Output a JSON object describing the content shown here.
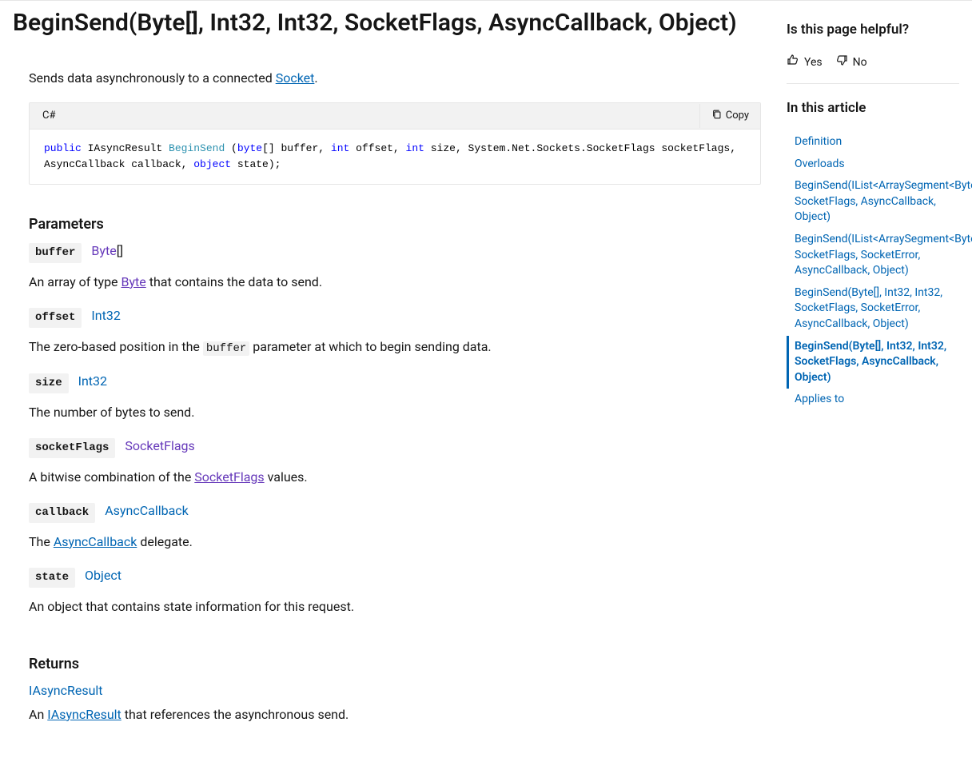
{
  "title": "BeginSend(Byte[], Int32, Int32, SocketFlags, AsyncCallback, Object)",
  "intro_prefix": "Sends data asynchronously to a connected ",
  "intro_link": "Socket",
  "intro_suffix": ".",
  "code": {
    "lang": "C#",
    "copy_label": "Copy",
    "tokens": [
      {
        "t": "public ",
        "c": "k-blue"
      },
      {
        "t": "IAsyncResult ",
        "c": "k-dark"
      },
      {
        "t": "BeginSend ",
        "c": "k-teal"
      },
      {
        "t": "(",
        "c": "k-dark"
      },
      {
        "t": "byte",
        "c": "k-blue"
      },
      {
        "t": "[] buffer, ",
        "c": "k-dark"
      },
      {
        "t": "int",
        "c": "k-blue"
      },
      {
        "t": " offset, ",
        "c": "k-dark"
      },
      {
        "t": "int",
        "c": "k-blue"
      },
      {
        "t": " size, System.Net.Sockets.SocketFlags socketFlags, AsyncCallback callback, ",
        "c": "k-dark"
      },
      {
        "t": "object",
        "c": "k-blue"
      },
      {
        "t": " state);",
        "c": "k-dark"
      }
    ]
  },
  "parameters_heading": "Parameters",
  "parameters": [
    {
      "name": "buffer",
      "type_parts": [
        {
          "text": "Byte",
          "link": true,
          "visited": true
        },
        {
          "text": "[]",
          "link": false
        }
      ],
      "desc_parts": [
        {
          "text": "An array of type "
        },
        {
          "text": "Byte",
          "link": true,
          "underline": true,
          "visited": true
        },
        {
          "text": " that contains the data to send."
        }
      ]
    },
    {
      "name": "offset",
      "type_parts": [
        {
          "text": "Int32",
          "link": true
        }
      ],
      "desc_parts": [
        {
          "text": "The zero-based position in the "
        },
        {
          "text": "buffer",
          "code": true
        },
        {
          "text": " parameter at which to begin sending data."
        }
      ]
    },
    {
      "name": "size",
      "type_parts": [
        {
          "text": "Int32",
          "link": true
        }
      ],
      "desc_parts": [
        {
          "text": "The number of bytes to send."
        }
      ]
    },
    {
      "name": "socketFlags",
      "type_parts": [
        {
          "text": "SocketFlags",
          "link": true,
          "visited": true
        }
      ],
      "desc_parts": [
        {
          "text": "A bitwise combination of the "
        },
        {
          "text": "SocketFlags",
          "link": true,
          "underline": true,
          "visited": true
        },
        {
          "text": " values."
        }
      ]
    },
    {
      "name": "callback",
      "type_parts": [
        {
          "text": "AsyncCallback",
          "link": true
        }
      ],
      "desc_parts": [
        {
          "text": "The "
        },
        {
          "text": "AsyncCallback",
          "link": true,
          "underline": true
        },
        {
          "text": " delegate."
        }
      ]
    },
    {
      "name": "state",
      "type_parts": [
        {
          "text": "Object",
          "link": true
        }
      ],
      "desc_parts": [
        {
          "text": "An object that contains state information for this request."
        }
      ]
    }
  ],
  "returns_heading": "Returns",
  "returns_type": "IAsyncResult",
  "returns_desc_parts": [
    {
      "text": "An "
    },
    {
      "text": "IAsyncResult",
      "link": true,
      "underline": true
    },
    {
      "text": " that references the asynchronous send."
    }
  ],
  "aside": {
    "helpful_heading": "Is this page helpful?",
    "yes": "Yes",
    "no": "No",
    "toc_heading": "In this article",
    "toc": [
      {
        "label": "Definition"
      },
      {
        "label": "Overloads"
      },
      {
        "label": "BeginSend(IList<ArraySegment<Byte>>, SocketFlags, AsyncCallback, Object)"
      },
      {
        "label": "BeginSend(IList<ArraySegment<Byte>>, SocketFlags, SocketError, AsyncCallback, Object)"
      },
      {
        "label": "BeginSend(Byte[], Int32, Int32, SocketFlags, SocketError, AsyncCallback, Object)"
      },
      {
        "label": "BeginSend(Byte[], Int32, Int32, SocketFlags, AsyncCallback, Object)",
        "active": true
      },
      {
        "label": "Applies to"
      }
    ]
  }
}
